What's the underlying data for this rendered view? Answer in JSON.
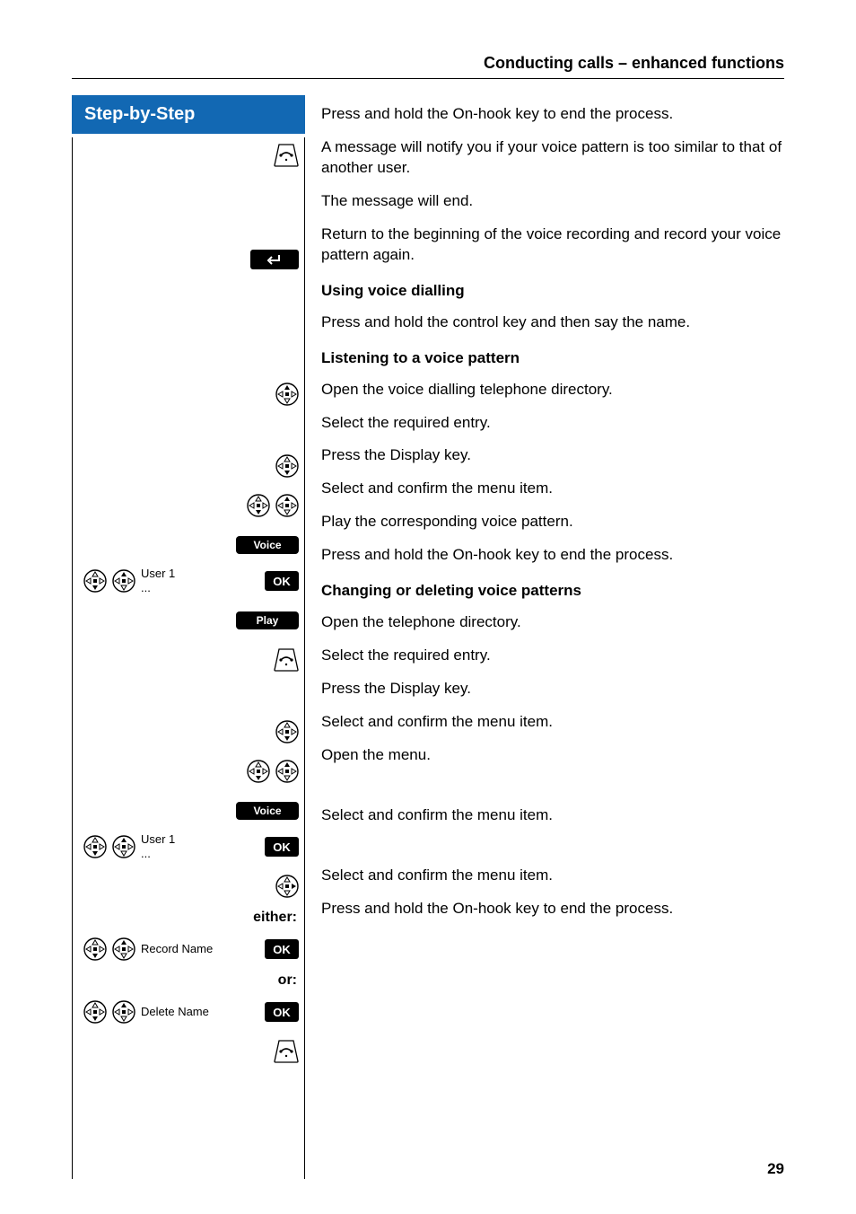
{
  "header": {
    "section_title": "Conducting calls – enhanced functions"
  },
  "sidebar": {
    "banner": "Step-by-Step"
  },
  "labels": {
    "voice_key": "Voice",
    "play_key": "Play",
    "ok_key": "OK",
    "user1": "User 1",
    "ellipsis": "...",
    "record_name": "Record Name",
    "delete_name": "Delete Name",
    "either": "either:",
    "or": "or:"
  },
  "body": {
    "p1": "Press and hold the On-hook key to end the process.",
    "p2": "A message will notify you if your voice pattern is too similar to that of another user.",
    "p3": "The message will end.",
    "p4": "Return to the beginning of the voice recording and record your voice pattern again.",
    "h1": "Using voice dialling",
    "p5": "Press and hold the control key and then say the name.",
    "h2": "Listening to a voice pattern",
    "p6": "Open the voice dialling telephone directory.",
    "p7": "Select the required entry.",
    "p8": "Press the Display key.",
    "p9": "Select and confirm the menu item.",
    "p10": "Play the corresponding voice pattern.",
    "p11": "Press and hold the On-hook key to end the process.",
    "h3": "Changing or deleting voice patterns",
    "p12": "Open the telephone directory.",
    "p13": "Select the required entry.",
    "p14": "Press the Display key.",
    "p15": "Select and confirm the menu item.",
    "p16": "Open the menu.",
    "p17": "Select and confirm the menu item.",
    "p18": "Select and confirm the menu item.",
    "p19": "Press and hold the On-hook key to end the process."
  },
  "page_number": "29"
}
